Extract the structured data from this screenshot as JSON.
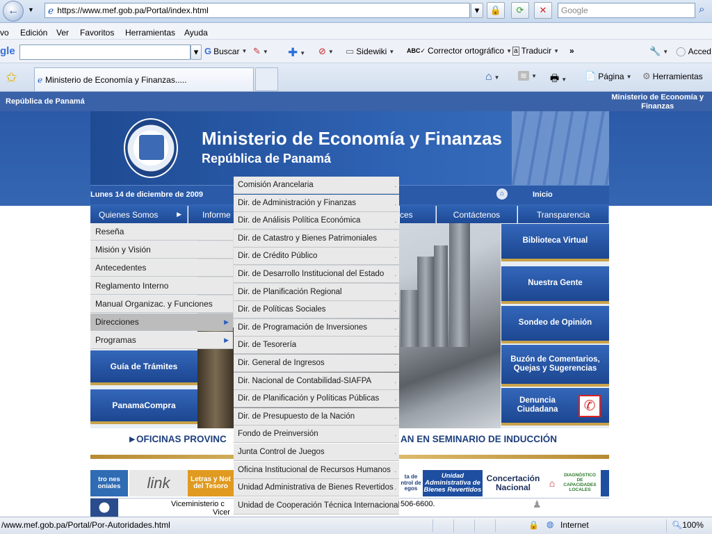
{
  "browser": {
    "url": "https://www.mef.gob.pa/Portal/index.html",
    "search_placeholder": "Google",
    "menu": [
      "vo",
      "Edición",
      "Ver",
      "Favoritos",
      "Herramientas",
      "Ayuda"
    ],
    "google_logo_fragment": "gle",
    "toolbar": {
      "search_btn": "Buscar",
      "sidewiki": "Sidewiki",
      "corrector": "Corrector ortográfico",
      "traducir": "Traducir",
      "more": "»",
      "acced": "Acced"
    },
    "tab_title": "Ministerio de Economía y Finanzas.....",
    "cmd": {
      "pagina": "Página",
      "herramientas": "Herramientas"
    }
  },
  "site": {
    "top_left": "República de Panamá",
    "top_right_1": "Ministerio de Economía y",
    "top_right_2": "Finanzas",
    "banner_title": "Ministerio de Economía y Finanzas",
    "banner_subtitle": "República de Panamá",
    "date": "Lunes 14 de diciembre de 2009",
    "inicio": "Inicio",
    "nav": {
      "quienes": "Quienes Somos",
      "informes": "Informe",
      "ces": "ces",
      "contactenos": "Contáctenos",
      "transparencia": "Transparencia"
    },
    "side_buttons": [
      "Biblioteca Virtual",
      "Nuestra Gente",
      "Sondeo de Opinión",
      "Buzón de Comentarios, Quejas y Sugerencias",
      "Denuncia Ciudadana"
    ],
    "left_buttons": [
      "Guía de Trámites",
      "PanamaCompra"
    ],
    "ticker_left": "OFICINAS PROVINC",
    "ticker_right": "AN EN SEMINARIO DE INDUCCIÓN",
    "logos": {
      "l1": "tro nes oniales",
      "l2": "link",
      "l3": "Letras y Not del Tesoro",
      "l4": "ta de ntrol de egos",
      "l5": "Unidad Administrativa de Bienes Revertidos",
      "l6": "Concertación Nacional",
      "l7": "DIAGNÓSTICO DE CAPACIDADES LOCALES"
    },
    "footer_left": "Viceministerio c",
    "footer_left2": "Vicer",
    "footer_right": "506-6600."
  },
  "menu_level1": [
    "Reseña",
    "Misión y Visión",
    "Antecedentes",
    "Reglamento Interno",
    "Manual Organizac. y Funciones",
    "Direcciones",
    "Programas"
  ],
  "menu_level2": [
    "Comisión Arancelaria",
    "Dir. de Administración y Finanzas",
    "Dir. de Análisis Política Económica",
    "Dir. de Catastro y Bienes Patrimoniales",
    "Dir. de Crédito Público",
    "Dir. de Desarrollo Institucional del Estado",
    "Dir. de Planificación Regional",
    "Dir. de Políticas Sociales",
    "Dir. de Programación de Inversiones",
    "Dir. de Tesorería",
    "Dir. General de Ingresos",
    "Dir. Nacional de Contabilidad-SIAFPA",
    "Dir. de Planificación y Políticas Públicas",
    "Dir. de Presupuesto de la Nación",
    "Fondo de Preinversión",
    "Junta Control de Juegos",
    "Oficina Institucional de Recursos Humanos",
    "Unidad Administrativa de Bienes Revertidos",
    "Unidad de Cooperación Técnica Internacional"
  ],
  "status": {
    "url": "/www.mef.gob.pa/Portal/Por-Autoridades.html",
    "zone": "Internet",
    "zoom": "100%"
  }
}
